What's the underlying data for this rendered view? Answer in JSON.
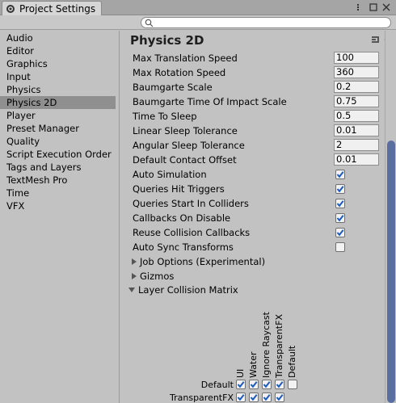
{
  "window": {
    "title": "Project Settings"
  },
  "sidebar": {
    "items": [
      "Audio",
      "Editor",
      "Graphics",
      "Input",
      "Physics",
      "Physics 2D",
      "Player",
      "Preset Manager",
      "Quality",
      "Script Execution Order",
      "Tags and Layers",
      "TextMesh Pro",
      "Time",
      "VFX"
    ],
    "selected": "Physics 2D"
  },
  "content": {
    "title": "Physics 2D",
    "fields": [
      {
        "label": "Max Translation Speed",
        "value": "100"
      },
      {
        "label": "Max Rotation Speed",
        "value": "360"
      },
      {
        "label": "Baumgarte Scale",
        "value": "0.2"
      },
      {
        "label": "Baumgarte Time Of Impact Scale",
        "value": "0.75"
      },
      {
        "label": "Time To Sleep",
        "value": "0.5"
      },
      {
        "label": "Linear Sleep Tolerance",
        "value": "0.01"
      },
      {
        "label": "Angular Sleep Tolerance",
        "value": "2"
      },
      {
        "label": "Default Contact Offset",
        "value": "0.01"
      }
    ],
    "toggles": [
      {
        "label": "Auto Simulation",
        "checked": true
      },
      {
        "label": "Queries Hit Triggers",
        "checked": true
      },
      {
        "label": "Queries Start In Colliders",
        "checked": true
      },
      {
        "label": "Callbacks On Disable",
        "checked": true
      },
      {
        "label": "Reuse Collision Callbacks",
        "checked": true
      },
      {
        "label": "Auto Sync Transforms",
        "checked": false
      }
    ],
    "foldouts": {
      "job_options": "Job Options (Experimental)",
      "gizmos": "Gizmos",
      "layer_matrix": "Layer Collision Matrix"
    },
    "matrix": {
      "columns": [
        "UI",
        "Water",
        "Ignore Raycast",
        "TransparentFX",
        "Default"
      ],
      "rows": [
        {
          "label": "Default",
          "checks": [
            true,
            true,
            true,
            true,
            false
          ]
        },
        {
          "label": "TransparentFX",
          "checks": [
            true,
            true,
            true,
            true
          ]
        }
      ]
    }
  },
  "colors": {
    "accent": "#1a5bbd",
    "selected_bg": "#8f8f8f",
    "scroll_thumb": "#5a6fa0"
  }
}
